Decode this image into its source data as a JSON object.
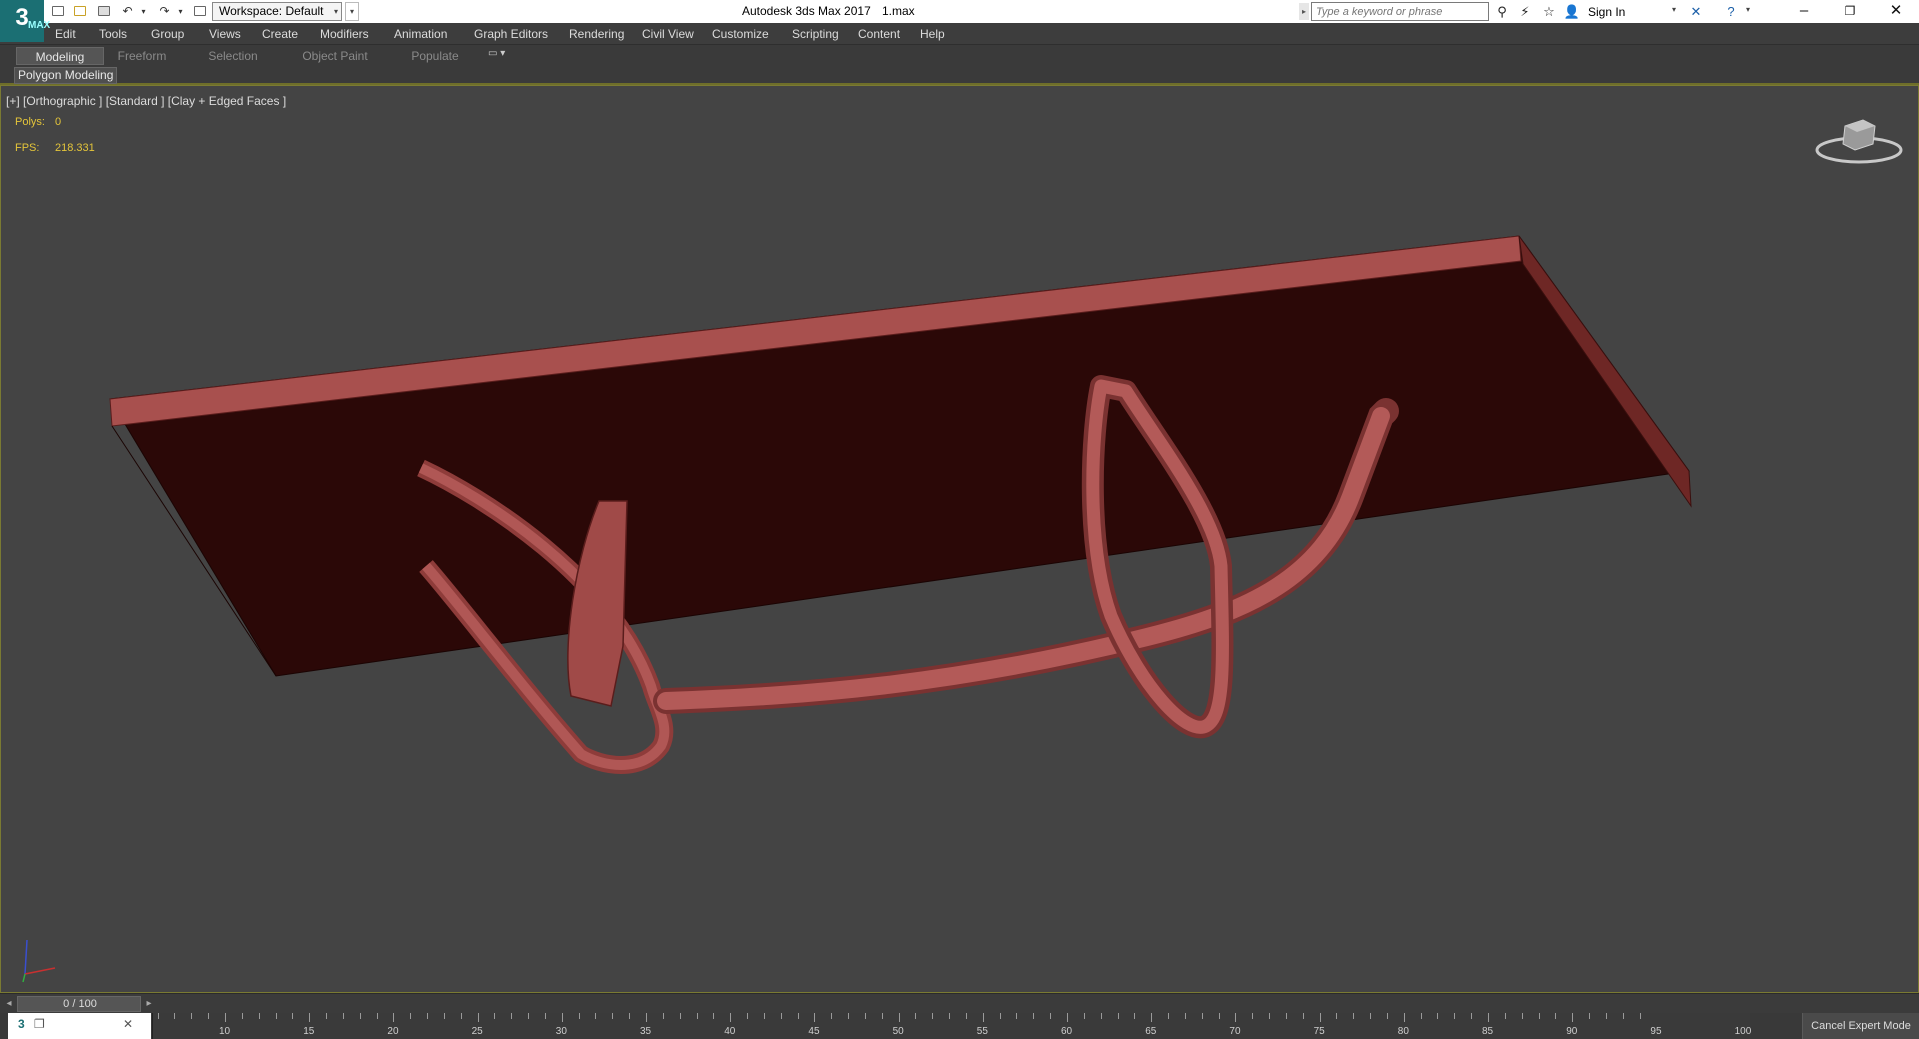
{
  "app": {
    "title": "Autodesk 3ds Max 2017",
    "file": "1.max",
    "logo_text": "3",
    "logo_sub": "MAX",
    "workspace_label": "Workspace: Default"
  },
  "search": {
    "placeholder": "Type a keyword or phrase"
  },
  "account": {
    "sign_in": "Sign In"
  },
  "menu": [
    "Edit",
    "Tools",
    "Group",
    "Views",
    "Create",
    "Modifiers",
    "Animation",
    "Graph Editors",
    "Rendering",
    "Civil View",
    "Customize",
    "Scripting",
    "Content",
    "Help"
  ],
  "ribbon": {
    "tabs": [
      "Modeling",
      "Freeform",
      "Selection",
      "Object Paint",
      "Populate"
    ],
    "active_tab": "Modeling",
    "panel_label": "Polygon Modeling"
  },
  "viewport": {
    "label": "[+] [Orthographic ] [Standard ] [Clay + Edged Faces ]",
    "stats": {
      "polys_label": "Polys:",
      "polys_value": "0",
      "fps_label": "FPS:",
      "fps_value": "218.331"
    },
    "object_color": "#a8504e",
    "face_dark": "#2b0807"
  },
  "timeslider": {
    "label": "0 / 100",
    "frame": 0,
    "total": 100
  },
  "timeline": {
    "ticks": [
      "10",
      "15",
      "20",
      "25",
      "30",
      "35",
      "40",
      "45",
      "50",
      "55",
      "60",
      "65",
      "70",
      "75",
      "80",
      "85",
      "90",
      "95",
      "100"
    ]
  },
  "statusbar": {
    "cancel_expert": "Cancel Expert Mode"
  },
  "colors": {
    "accent": "#1b6f73",
    "viewport_bg": "#444444",
    "stats_text": "#e4c53a"
  }
}
